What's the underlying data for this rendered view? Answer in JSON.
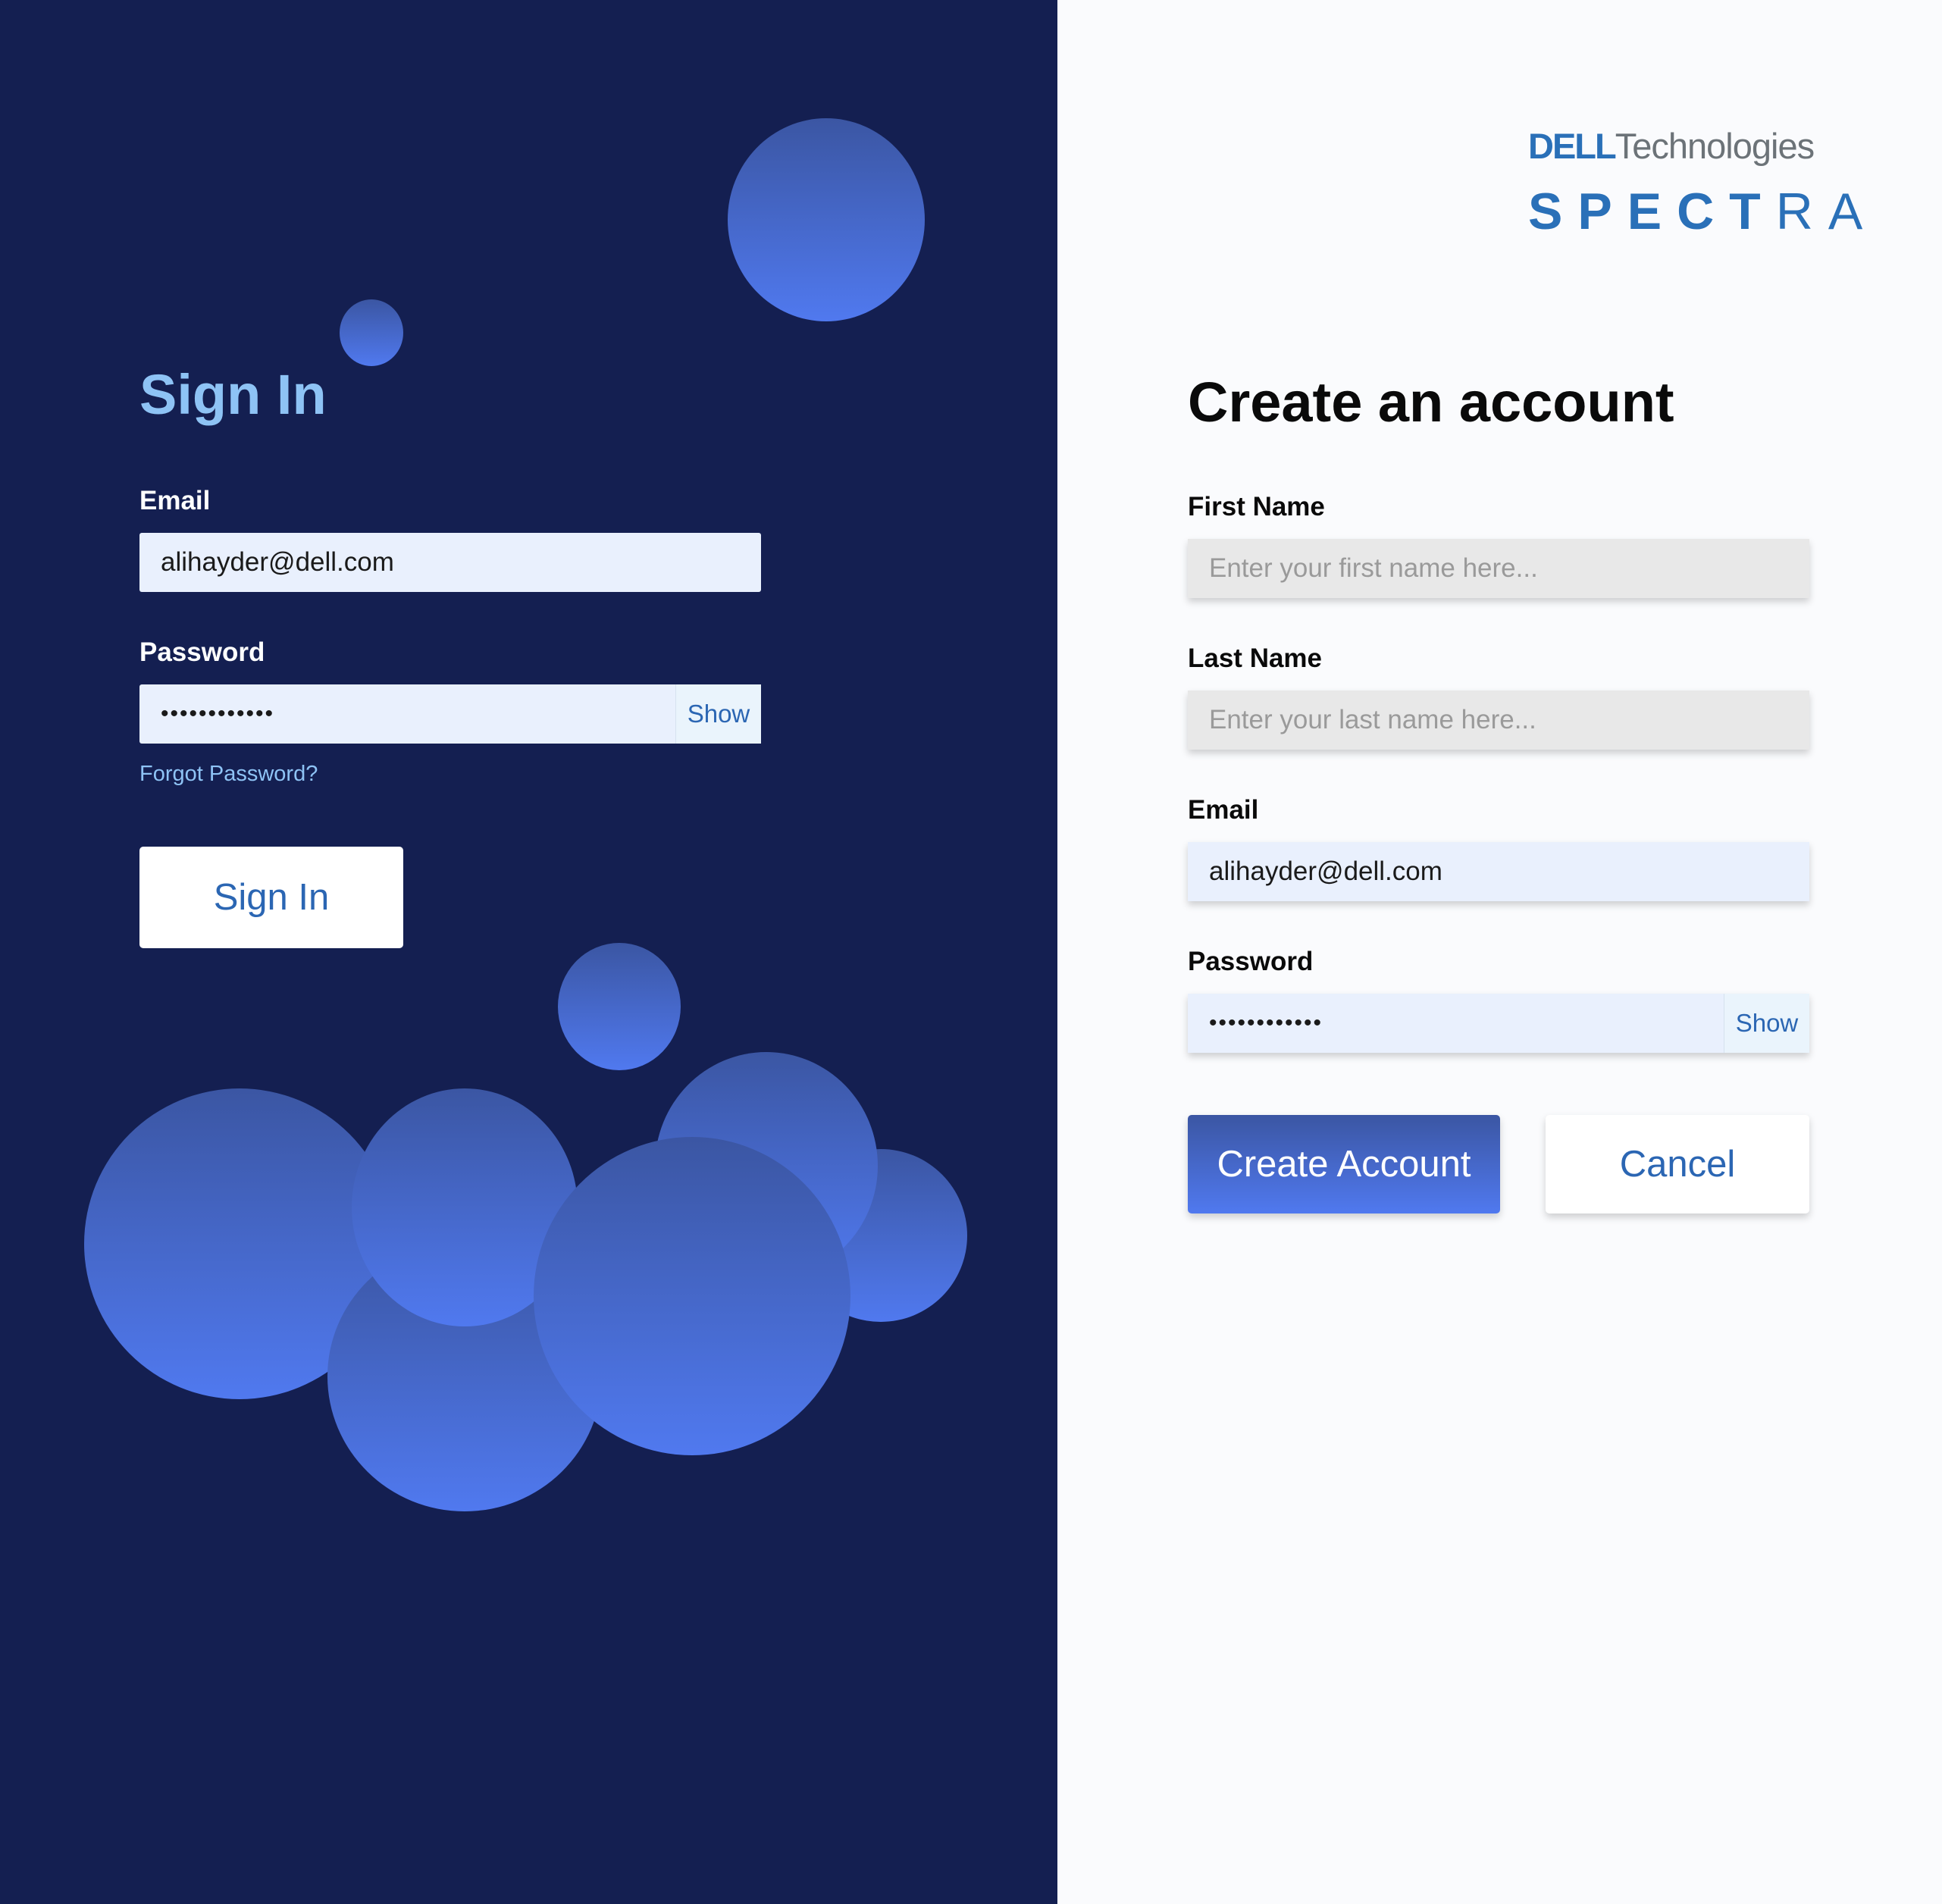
{
  "colors": {
    "left_background": "#141f51",
    "right_background": "#fafbfd",
    "accent": "#2b66b3",
    "bubble_gradient_top": "#3b56a3",
    "bubble_gradient_bottom": "#5079ef",
    "signin_title": "#8ec3f5"
  },
  "signin": {
    "title": "Sign In",
    "email_label": "Email",
    "email_value": "alihayder@dell.com",
    "password_label": "Password",
    "password_value": "••••••••••••",
    "show_label": "Show",
    "forgot_label": "Forgot Password?",
    "button_label": "Sign In"
  },
  "brand": {
    "company_mark": "DELL",
    "company_suffix": "Technologies",
    "product_bold": "SPECT",
    "product_light": "RA"
  },
  "register": {
    "title": "Create an account",
    "first_name_label": "First Name",
    "first_name_placeholder": "Enter your first name here...",
    "last_name_label": "Last Name",
    "last_name_placeholder": "Enter your last name here...",
    "email_label": "Email",
    "email_value": "alihayder@dell.com",
    "password_label": "Password",
    "password_value": "••••••••••••",
    "show_label": "Show",
    "create_button_label": "Create Account",
    "cancel_button_label": "Cancel"
  }
}
